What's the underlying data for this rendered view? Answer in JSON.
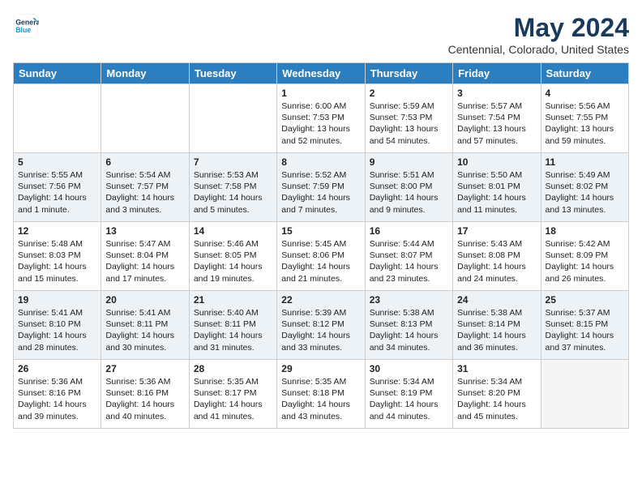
{
  "header": {
    "logo_line1": "General",
    "logo_line2": "Blue",
    "month_title": "May 2024",
    "location": "Centennial, Colorado, United States"
  },
  "days_of_week": [
    "Sunday",
    "Monday",
    "Tuesday",
    "Wednesday",
    "Thursday",
    "Friday",
    "Saturday"
  ],
  "weeks": [
    [
      {
        "num": "",
        "sunrise": "",
        "sunset": "",
        "daylight": "",
        "empty": true
      },
      {
        "num": "",
        "sunrise": "",
        "sunset": "",
        "daylight": "",
        "empty": true
      },
      {
        "num": "",
        "sunrise": "",
        "sunset": "",
        "daylight": "",
        "empty": true
      },
      {
        "num": "1",
        "sunrise": "Sunrise: 6:00 AM",
        "sunset": "Sunset: 7:53 PM",
        "daylight": "Daylight: 13 hours and 52 minutes.",
        "empty": false
      },
      {
        "num": "2",
        "sunrise": "Sunrise: 5:59 AM",
        "sunset": "Sunset: 7:53 PM",
        "daylight": "Daylight: 13 hours and 54 minutes.",
        "empty": false
      },
      {
        "num": "3",
        "sunrise": "Sunrise: 5:57 AM",
        "sunset": "Sunset: 7:54 PM",
        "daylight": "Daylight: 13 hours and 57 minutes.",
        "empty": false
      },
      {
        "num": "4",
        "sunrise": "Sunrise: 5:56 AM",
        "sunset": "Sunset: 7:55 PM",
        "daylight": "Daylight: 13 hours and 59 minutes.",
        "empty": false
      }
    ],
    [
      {
        "num": "5",
        "sunrise": "Sunrise: 5:55 AM",
        "sunset": "Sunset: 7:56 PM",
        "daylight": "Daylight: 14 hours and 1 minute.",
        "empty": false
      },
      {
        "num": "6",
        "sunrise": "Sunrise: 5:54 AM",
        "sunset": "Sunset: 7:57 PM",
        "daylight": "Daylight: 14 hours and 3 minutes.",
        "empty": false
      },
      {
        "num": "7",
        "sunrise": "Sunrise: 5:53 AM",
        "sunset": "Sunset: 7:58 PM",
        "daylight": "Daylight: 14 hours and 5 minutes.",
        "empty": false
      },
      {
        "num": "8",
        "sunrise": "Sunrise: 5:52 AM",
        "sunset": "Sunset: 7:59 PM",
        "daylight": "Daylight: 14 hours and 7 minutes.",
        "empty": false
      },
      {
        "num": "9",
        "sunrise": "Sunrise: 5:51 AM",
        "sunset": "Sunset: 8:00 PM",
        "daylight": "Daylight: 14 hours and 9 minutes.",
        "empty": false
      },
      {
        "num": "10",
        "sunrise": "Sunrise: 5:50 AM",
        "sunset": "Sunset: 8:01 PM",
        "daylight": "Daylight: 14 hours and 11 minutes.",
        "empty": false
      },
      {
        "num": "11",
        "sunrise": "Sunrise: 5:49 AM",
        "sunset": "Sunset: 8:02 PM",
        "daylight": "Daylight: 14 hours and 13 minutes.",
        "empty": false
      }
    ],
    [
      {
        "num": "12",
        "sunrise": "Sunrise: 5:48 AM",
        "sunset": "Sunset: 8:03 PM",
        "daylight": "Daylight: 14 hours and 15 minutes.",
        "empty": false
      },
      {
        "num": "13",
        "sunrise": "Sunrise: 5:47 AM",
        "sunset": "Sunset: 8:04 PM",
        "daylight": "Daylight: 14 hours and 17 minutes.",
        "empty": false
      },
      {
        "num": "14",
        "sunrise": "Sunrise: 5:46 AM",
        "sunset": "Sunset: 8:05 PM",
        "daylight": "Daylight: 14 hours and 19 minutes.",
        "empty": false
      },
      {
        "num": "15",
        "sunrise": "Sunrise: 5:45 AM",
        "sunset": "Sunset: 8:06 PM",
        "daylight": "Daylight: 14 hours and 21 minutes.",
        "empty": false
      },
      {
        "num": "16",
        "sunrise": "Sunrise: 5:44 AM",
        "sunset": "Sunset: 8:07 PM",
        "daylight": "Daylight: 14 hours and 23 minutes.",
        "empty": false
      },
      {
        "num": "17",
        "sunrise": "Sunrise: 5:43 AM",
        "sunset": "Sunset: 8:08 PM",
        "daylight": "Daylight: 14 hours and 24 minutes.",
        "empty": false
      },
      {
        "num": "18",
        "sunrise": "Sunrise: 5:42 AM",
        "sunset": "Sunset: 8:09 PM",
        "daylight": "Daylight: 14 hours and 26 minutes.",
        "empty": false
      }
    ],
    [
      {
        "num": "19",
        "sunrise": "Sunrise: 5:41 AM",
        "sunset": "Sunset: 8:10 PM",
        "daylight": "Daylight: 14 hours and 28 minutes.",
        "empty": false
      },
      {
        "num": "20",
        "sunrise": "Sunrise: 5:41 AM",
        "sunset": "Sunset: 8:11 PM",
        "daylight": "Daylight: 14 hours and 30 minutes.",
        "empty": false
      },
      {
        "num": "21",
        "sunrise": "Sunrise: 5:40 AM",
        "sunset": "Sunset: 8:11 PM",
        "daylight": "Daylight: 14 hours and 31 minutes.",
        "empty": false
      },
      {
        "num": "22",
        "sunrise": "Sunrise: 5:39 AM",
        "sunset": "Sunset: 8:12 PM",
        "daylight": "Daylight: 14 hours and 33 minutes.",
        "empty": false
      },
      {
        "num": "23",
        "sunrise": "Sunrise: 5:38 AM",
        "sunset": "Sunset: 8:13 PM",
        "daylight": "Daylight: 14 hours and 34 minutes.",
        "empty": false
      },
      {
        "num": "24",
        "sunrise": "Sunrise: 5:38 AM",
        "sunset": "Sunset: 8:14 PM",
        "daylight": "Daylight: 14 hours and 36 minutes.",
        "empty": false
      },
      {
        "num": "25",
        "sunrise": "Sunrise: 5:37 AM",
        "sunset": "Sunset: 8:15 PM",
        "daylight": "Daylight: 14 hours and 37 minutes.",
        "empty": false
      }
    ],
    [
      {
        "num": "26",
        "sunrise": "Sunrise: 5:36 AM",
        "sunset": "Sunset: 8:16 PM",
        "daylight": "Daylight: 14 hours and 39 minutes.",
        "empty": false
      },
      {
        "num": "27",
        "sunrise": "Sunrise: 5:36 AM",
        "sunset": "Sunset: 8:16 PM",
        "daylight": "Daylight: 14 hours and 40 minutes.",
        "empty": false
      },
      {
        "num": "28",
        "sunrise": "Sunrise: 5:35 AM",
        "sunset": "Sunset: 8:17 PM",
        "daylight": "Daylight: 14 hours and 41 minutes.",
        "empty": false
      },
      {
        "num": "29",
        "sunrise": "Sunrise: 5:35 AM",
        "sunset": "Sunset: 8:18 PM",
        "daylight": "Daylight: 14 hours and 43 minutes.",
        "empty": false
      },
      {
        "num": "30",
        "sunrise": "Sunrise: 5:34 AM",
        "sunset": "Sunset: 8:19 PM",
        "daylight": "Daylight: 14 hours and 44 minutes.",
        "empty": false
      },
      {
        "num": "31",
        "sunrise": "Sunrise: 5:34 AM",
        "sunset": "Sunset: 8:20 PM",
        "daylight": "Daylight: 14 hours and 45 minutes.",
        "empty": false
      },
      {
        "num": "",
        "sunrise": "",
        "sunset": "",
        "daylight": "",
        "empty": true
      }
    ]
  ]
}
